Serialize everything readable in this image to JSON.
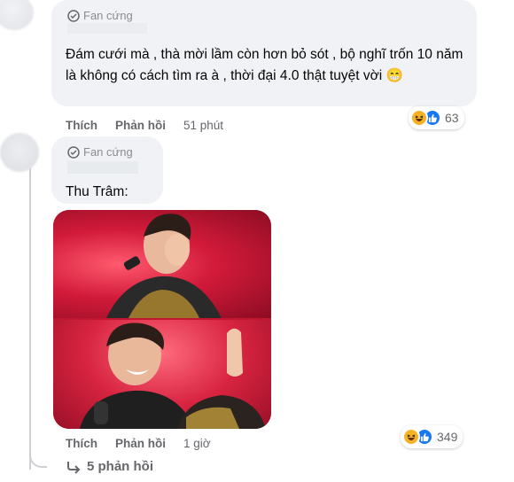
{
  "comment1": {
    "badge": "Fan cứng",
    "text": "Đám cưới mà , thà mời lầm còn hơn bỏ sót , bộ nghĩ trốn 10 năm là không có cách tìm ra à , thời đại 4.0 thật tuyệt vời 😁",
    "actions": {
      "like": "Thích",
      "reply": "Phản hồi",
      "time": "51 phút"
    },
    "reaction_count": "63",
    "reaction_icons": [
      "haha-icon",
      "like-icon"
    ]
  },
  "comment2": {
    "badge": "Fan cứng",
    "text": "Thu Trâm:",
    "actions": {
      "like": "Thích",
      "reply": "Phản hồi",
      "time": "1 giờ"
    },
    "reaction_count": "349",
    "reaction_icons": [
      "haha-icon",
      "like-icon"
    ]
  },
  "replies": {
    "label": "5 phản hồi"
  },
  "colors": {
    "bubble": "#f0f2f5",
    "meta_text": "#65676b",
    "like_blue": "#1877f2",
    "haha_yellow": "#f7b125",
    "stage_red": "#c21530"
  }
}
